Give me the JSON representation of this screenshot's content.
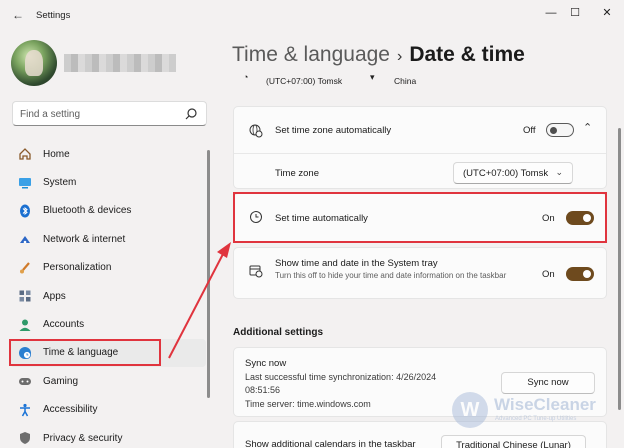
{
  "window": {
    "title": "Settings",
    "back_icon": "arrow-left-icon",
    "controls": {
      "minimize": "—",
      "maximize": "☐",
      "close": "✕"
    }
  },
  "sidebar": {
    "search_placeholder": "Find a setting",
    "items": [
      {
        "label": "Home",
        "icon": "home-icon",
        "color": "#8a5a2b"
      },
      {
        "label": "System",
        "icon": "monitor-icon",
        "color": "#1f8fd6"
      },
      {
        "label": "Bluetooth & devices",
        "icon": "bluetooth-icon",
        "color": "#1a6fd0"
      },
      {
        "label": "Network & internet",
        "icon": "wifi-icon",
        "color": "#2b66c6"
      },
      {
        "label": "Personalization",
        "icon": "brush-icon",
        "color": "#d07a2a"
      },
      {
        "label": "Apps",
        "icon": "apps-icon",
        "color": "#5b6c84"
      },
      {
        "label": "Accounts",
        "icon": "person-icon",
        "color": "#2f9a6a"
      },
      {
        "label": "Time & language",
        "icon": "globe-clock-icon",
        "color": "#2a7fd0"
      },
      {
        "label": "Gaming",
        "icon": "gamepad-icon",
        "color": "#6d6d6d"
      },
      {
        "label": "Accessibility",
        "icon": "accessibility-icon",
        "color": "#1a73d6"
      },
      {
        "label": "Privacy & security",
        "icon": "shield-icon",
        "color": "#6d6d6d"
      }
    ],
    "active_index": 7
  },
  "main": {
    "breadcrumb_parent": "Time & language",
    "breadcrumb_separator": "›",
    "breadcrumb_current": "Date & time",
    "top_strip": {
      "zone": "(UTC+07:00) Tomsk",
      "country": "China"
    },
    "timezone_auto": {
      "label": "Set time zone automatically",
      "state_label": "Off",
      "on": false
    },
    "timezone": {
      "label": "Time zone",
      "value": "(UTC+07:00) Tomsk",
      "chevron": "⌄"
    },
    "time_auto": {
      "label": "Set time automatically",
      "state_label": "On",
      "on": true
    },
    "tray": {
      "label": "Show time and date in the System tray",
      "description": "Turn this off to hide your time and date information on the taskbar",
      "state_label": "On",
      "on": true
    },
    "additional_title": "Additional settings",
    "sync": {
      "title": "Sync now",
      "last_sync": "Last successful time synchronization: 4/26/2024",
      "last_sync_time": "08:51:56",
      "server": "Time server: time.windows.com",
      "button": "Sync now"
    },
    "calendars": {
      "label": "Show additional calendars in the taskbar",
      "value": "Traditional Chinese (Lunar)"
    }
  },
  "watermark": {
    "letter": "W",
    "name": "WiseCleaner",
    "tagline": "Advanced PC Tune-up Utilities"
  },
  "accent": {
    "toggle_on": "#6e4a1e",
    "highlight": "#e0343e"
  }
}
